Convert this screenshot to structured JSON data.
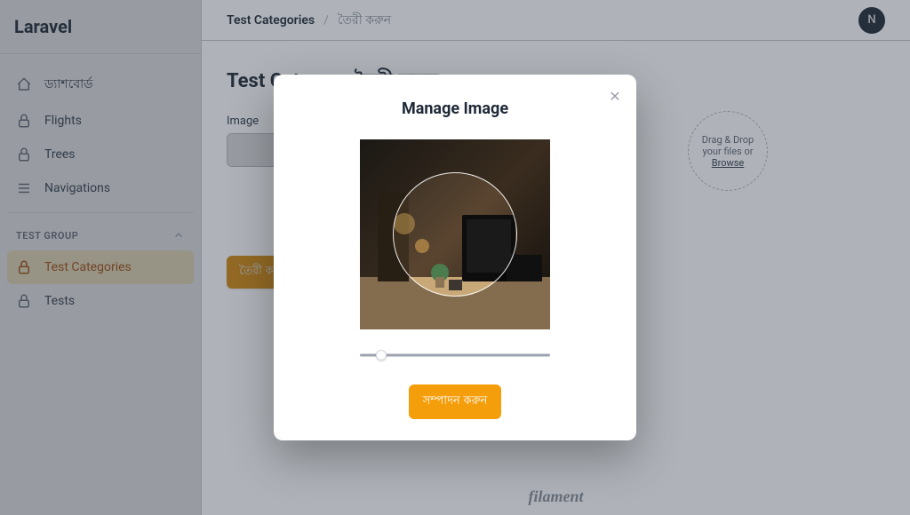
{
  "brand": "Laravel",
  "sidebar": {
    "items": [
      {
        "label": "ড্যাশবোর্ড"
      },
      {
        "label": "Flights"
      },
      {
        "label": "Trees"
      },
      {
        "label": "Navigations"
      }
    ],
    "group_label": "TEST GROUP",
    "group_items": [
      {
        "label": "Test Categories"
      },
      {
        "label": "Tests"
      }
    ]
  },
  "breadcrumb": {
    "parent": "Test Categories",
    "current": "তৈরী করুন"
  },
  "avatar_letter": "N",
  "page": {
    "title": "Test Category তৈরী করুন",
    "image_label": "Image",
    "submit_label": "তৈরী করুন"
  },
  "dropzone": {
    "line1": "Drag & Drop",
    "line2": "your files or",
    "browse": "Browse"
  },
  "modal": {
    "title": "Manage Image",
    "submit_label": "সম্পাদন করুন"
  },
  "footer": "filament"
}
